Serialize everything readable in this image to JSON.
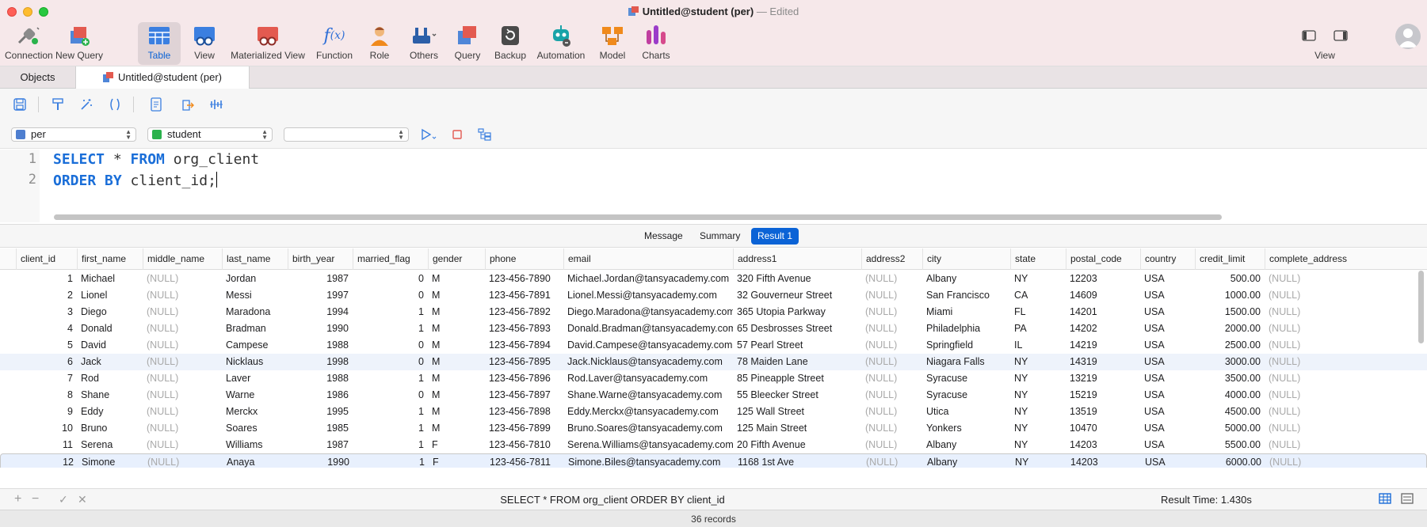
{
  "window": {
    "title": "Untitled@student (per)",
    "status": "— Edited"
  },
  "toolbar": {
    "items": [
      {
        "label": "Connection",
        "icon": "connection-icon"
      },
      {
        "label": "New Query",
        "icon": "new-query-icon"
      },
      {
        "label": "Table",
        "icon": "table-icon",
        "active": true
      },
      {
        "label": "View",
        "icon": "view-icon"
      },
      {
        "label": "Materialized View",
        "icon": "materialized-view-icon"
      },
      {
        "label": "Function",
        "icon": "function-icon"
      },
      {
        "label": "Role",
        "icon": "role-icon"
      },
      {
        "label": "Others",
        "icon": "others-icon"
      },
      {
        "label": "Query",
        "icon": "query-icon"
      },
      {
        "label": "Backup",
        "icon": "backup-icon"
      },
      {
        "label": "Automation",
        "icon": "automation-icon"
      },
      {
        "label": "Model",
        "icon": "model-icon"
      },
      {
        "label": "Charts",
        "icon": "charts-icon"
      }
    ],
    "view_label": "View"
  },
  "tabs": {
    "objects": "Objects",
    "query": "Untitled@student (per)"
  },
  "selectors": {
    "connection": "per",
    "database": "student",
    "schema": ""
  },
  "editor": {
    "lines": [
      {
        "n": "1",
        "kw1": "SELECT",
        "t1": " * ",
        "kw2": "FROM",
        "t2": " org_client"
      },
      {
        "n": "2",
        "kw1": "ORDER BY",
        "t1": " client_id;",
        "kw2": "",
        "t2": ""
      }
    ]
  },
  "result_tabs": [
    "Message",
    "Summary",
    "Result 1"
  ],
  "grid": {
    "columns": [
      "client_id",
      "first_name",
      "middle_name",
      "last_name",
      "birth_year",
      "married_flag",
      "gender",
      "phone",
      "email",
      "address1",
      "address2",
      "city",
      "state",
      "postal_code",
      "country",
      "credit_limit",
      "complete_address"
    ],
    "rows": [
      [
        "1",
        "Michael",
        "(NULL)",
        "Jordan",
        "1987",
        "0",
        "M",
        "123-456-7890",
        "Michael.Jordan@tansyacademy.com",
        "320 Fifth Avenue",
        "(NULL)",
        "Albany",
        "NY",
        "12203",
        "USA",
        "500.00",
        "(NULL)"
      ],
      [
        "2",
        "Lionel",
        "(NULL)",
        "Messi",
        "1997",
        "0",
        "M",
        "123-456-7891",
        "Lionel.Messi@tansyacademy.com",
        "32 Gouverneur Street",
        "(NULL)",
        "San Francisco",
        "CA",
        "14609",
        "USA",
        "1000.00",
        "(NULL)"
      ],
      [
        "3",
        "Diego",
        "(NULL)",
        "Maradona",
        "1994",
        "1",
        "M",
        "123-456-7892",
        "Diego.Maradona@tansyacademy.com",
        "365 Utopia Parkway",
        "(NULL)",
        "Miami",
        "FL",
        "14201",
        "USA",
        "1500.00",
        "(NULL)"
      ],
      [
        "4",
        "Donald",
        "(NULL)",
        "Bradman",
        "1990",
        "1",
        "M",
        "123-456-7893",
        "Donald.Bradman@tansyacademy.com",
        "65 Desbrosses Street",
        "(NULL)",
        "Philadelphia",
        "PA",
        "14202",
        "USA",
        "2000.00",
        "(NULL)"
      ],
      [
        "5",
        "David",
        "(NULL)",
        "Campese",
        "1988",
        "0",
        "M",
        "123-456-7894",
        "David.Campese@tansyacademy.com",
        "57 Pearl Street",
        "(NULL)",
        "Springfield",
        "IL",
        "14219",
        "USA",
        "2500.00",
        "(NULL)"
      ],
      [
        "6",
        "Jack",
        "(NULL)",
        "Nicklaus",
        "1998",
        "0",
        "M",
        "123-456-7895",
        "Jack.Nicklaus@tansyacademy.com",
        "78 Maiden Lane",
        "(NULL)",
        "Niagara Falls",
        "NY",
        "14319",
        "USA",
        "3000.00",
        "(NULL)"
      ],
      [
        "7",
        "Rod",
        "(NULL)",
        "Laver",
        "1988",
        "1",
        "M",
        "123-456-7896",
        "Rod.Laver@tansyacademy.com",
        "85 Pineapple Street",
        "(NULL)",
        "Syracuse",
        "NY",
        "13219",
        "USA",
        "3500.00",
        "(NULL)"
      ],
      [
        "8",
        "Shane",
        "(NULL)",
        "Warne",
        "1986",
        "0",
        "M",
        "123-456-7897",
        "Shane.Warne@tansyacademy.com",
        "55 Bleecker Street",
        "(NULL)",
        "Syracuse",
        "NY",
        "15219",
        "USA",
        "4000.00",
        "(NULL)"
      ],
      [
        "9",
        "Eddy",
        "(NULL)",
        "Merckx",
        "1995",
        "1",
        "M",
        "123-456-7898",
        "Eddy.Merckx@tansyacademy.com",
        "125 Wall Street",
        "(NULL)",
        "Utica",
        "NY",
        "13519",
        "USA",
        "4500.00",
        "(NULL)"
      ],
      [
        "10",
        "Bruno",
        "(NULL)",
        "Soares",
        "1985",
        "1",
        "M",
        "123-456-7899",
        "Bruno.Soares@tansyacademy.com",
        "125 Main Street",
        "(NULL)",
        "Yonkers",
        "NY",
        "10470",
        "USA",
        "5000.00",
        "(NULL)"
      ],
      [
        "11",
        "Serena",
        "(NULL)",
        "Williams",
        "1987",
        "1",
        "F",
        "123-456-7810",
        "Serena.Williams@tansyacademy.com",
        "20 Fifth Avenue",
        "(NULL)",
        "Albany",
        "NY",
        "14203",
        "USA",
        "5500.00",
        "(NULL)"
      ],
      [
        "12",
        "Simone",
        "(NULL)",
        "Anaya",
        "1990",
        "1",
        "F",
        "123-456-7811",
        "Simone.Biles@tansyacademy.com",
        "1168 1st Ave",
        "(NULL)",
        "Albany",
        "NY",
        "14203",
        "USA",
        "6000.00",
        "(NULL)"
      ]
    ]
  },
  "status": {
    "sql": "SELECT * FROM org_client ORDER BY client_id",
    "result_time": "Result Time: 1.430s",
    "records": "36 records"
  },
  "colors": {
    "accent": "#0b63d6",
    "keyword": "#1a6ed8",
    "null_text": "#a9a9a9"
  }
}
